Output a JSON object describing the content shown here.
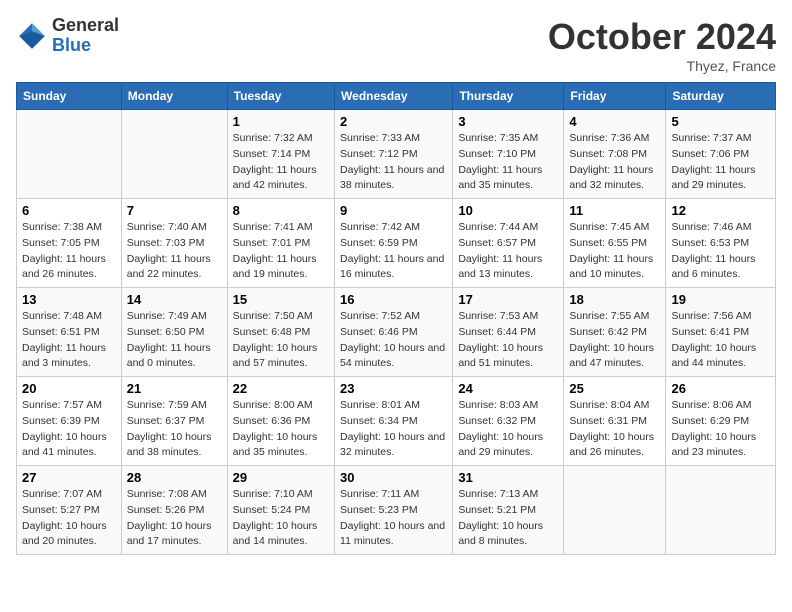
{
  "logo": {
    "general": "General",
    "blue": "Blue"
  },
  "header": {
    "month": "October 2024",
    "location": "Thyez, France"
  },
  "weekdays": [
    "Sunday",
    "Monday",
    "Tuesday",
    "Wednesday",
    "Thursday",
    "Friday",
    "Saturday"
  ],
  "weeks": [
    [
      {
        "day": "",
        "sunrise": "",
        "sunset": "",
        "daylight": ""
      },
      {
        "day": "",
        "sunrise": "",
        "sunset": "",
        "daylight": ""
      },
      {
        "day": "1",
        "sunrise": "Sunrise: 7:32 AM",
        "sunset": "Sunset: 7:14 PM",
        "daylight": "Daylight: 11 hours and 42 minutes."
      },
      {
        "day": "2",
        "sunrise": "Sunrise: 7:33 AM",
        "sunset": "Sunset: 7:12 PM",
        "daylight": "Daylight: 11 hours and 38 minutes."
      },
      {
        "day": "3",
        "sunrise": "Sunrise: 7:35 AM",
        "sunset": "Sunset: 7:10 PM",
        "daylight": "Daylight: 11 hours and 35 minutes."
      },
      {
        "day": "4",
        "sunrise": "Sunrise: 7:36 AM",
        "sunset": "Sunset: 7:08 PM",
        "daylight": "Daylight: 11 hours and 32 minutes."
      },
      {
        "day": "5",
        "sunrise": "Sunrise: 7:37 AM",
        "sunset": "Sunset: 7:06 PM",
        "daylight": "Daylight: 11 hours and 29 minutes."
      }
    ],
    [
      {
        "day": "6",
        "sunrise": "Sunrise: 7:38 AM",
        "sunset": "Sunset: 7:05 PM",
        "daylight": "Daylight: 11 hours and 26 minutes."
      },
      {
        "day": "7",
        "sunrise": "Sunrise: 7:40 AM",
        "sunset": "Sunset: 7:03 PM",
        "daylight": "Daylight: 11 hours and 22 minutes."
      },
      {
        "day": "8",
        "sunrise": "Sunrise: 7:41 AM",
        "sunset": "Sunset: 7:01 PM",
        "daylight": "Daylight: 11 hours and 19 minutes."
      },
      {
        "day": "9",
        "sunrise": "Sunrise: 7:42 AM",
        "sunset": "Sunset: 6:59 PM",
        "daylight": "Daylight: 11 hours and 16 minutes."
      },
      {
        "day": "10",
        "sunrise": "Sunrise: 7:44 AM",
        "sunset": "Sunset: 6:57 PM",
        "daylight": "Daylight: 11 hours and 13 minutes."
      },
      {
        "day": "11",
        "sunrise": "Sunrise: 7:45 AM",
        "sunset": "Sunset: 6:55 PM",
        "daylight": "Daylight: 11 hours and 10 minutes."
      },
      {
        "day": "12",
        "sunrise": "Sunrise: 7:46 AM",
        "sunset": "Sunset: 6:53 PM",
        "daylight": "Daylight: 11 hours and 6 minutes."
      }
    ],
    [
      {
        "day": "13",
        "sunrise": "Sunrise: 7:48 AM",
        "sunset": "Sunset: 6:51 PM",
        "daylight": "Daylight: 11 hours and 3 minutes."
      },
      {
        "day": "14",
        "sunrise": "Sunrise: 7:49 AM",
        "sunset": "Sunset: 6:50 PM",
        "daylight": "Daylight: 11 hours and 0 minutes."
      },
      {
        "day": "15",
        "sunrise": "Sunrise: 7:50 AM",
        "sunset": "Sunset: 6:48 PM",
        "daylight": "Daylight: 10 hours and 57 minutes."
      },
      {
        "day": "16",
        "sunrise": "Sunrise: 7:52 AM",
        "sunset": "Sunset: 6:46 PM",
        "daylight": "Daylight: 10 hours and 54 minutes."
      },
      {
        "day": "17",
        "sunrise": "Sunrise: 7:53 AM",
        "sunset": "Sunset: 6:44 PM",
        "daylight": "Daylight: 10 hours and 51 minutes."
      },
      {
        "day": "18",
        "sunrise": "Sunrise: 7:55 AM",
        "sunset": "Sunset: 6:42 PM",
        "daylight": "Daylight: 10 hours and 47 minutes."
      },
      {
        "day": "19",
        "sunrise": "Sunrise: 7:56 AM",
        "sunset": "Sunset: 6:41 PM",
        "daylight": "Daylight: 10 hours and 44 minutes."
      }
    ],
    [
      {
        "day": "20",
        "sunrise": "Sunrise: 7:57 AM",
        "sunset": "Sunset: 6:39 PM",
        "daylight": "Daylight: 10 hours and 41 minutes."
      },
      {
        "day": "21",
        "sunrise": "Sunrise: 7:59 AM",
        "sunset": "Sunset: 6:37 PM",
        "daylight": "Daylight: 10 hours and 38 minutes."
      },
      {
        "day": "22",
        "sunrise": "Sunrise: 8:00 AM",
        "sunset": "Sunset: 6:36 PM",
        "daylight": "Daylight: 10 hours and 35 minutes."
      },
      {
        "day": "23",
        "sunrise": "Sunrise: 8:01 AM",
        "sunset": "Sunset: 6:34 PM",
        "daylight": "Daylight: 10 hours and 32 minutes."
      },
      {
        "day": "24",
        "sunrise": "Sunrise: 8:03 AM",
        "sunset": "Sunset: 6:32 PM",
        "daylight": "Daylight: 10 hours and 29 minutes."
      },
      {
        "day": "25",
        "sunrise": "Sunrise: 8:04 AM",
        "sunset": "Sunset: 6:31 PM",
        "daylight": "Daylight: 10 hours and 26 minutes."
      },
      {
        "day": "26",
        "sunrise": "Sunrise: 8:06 AM",
        "sunset": "Sunset: 6:29 PM",
        "daylight": "Daylight: 10 hours and 23 minutes."
      }
    ],
    [
      {
        "day": "27",
        "sunrise": "Sunrise: 7:07 AM",
        "sunset": "Sunset: 5:27 PM",
        "daylight": "Daylight: 10 hours and 20 minutes."
      },
      {
        "day": "28",
        "sunrise": "Sunrise: 7:08 AM",
        "sunset": "Sunset: 5:26 PM",
        "daylight": "Daylight: 10 hours and 17 minutes."
      },
      {
        "day": "29",
        "sunrise": "Sunrise: 7:10 AM",
        "sunset": "Sunset: 5:24 PM",
        "daylight": "Daylight: 10 hours and 14 minutes."
      },
      {
        "day": "30",
        "sunrise": "Sunrise: 7:11 AM",
        "sunset": "Sunset: 5:23 PM",
        "daylight": "Daylight: 10 hours and 11 minutes."
      },
      {
        "day": "31",
        "sunrise": "Sunrise: 7:13 AM",
        "sunset": "Sunset: 5:21 PM",
        "daylight": "Daylight: 10 hours and 8 minutes."
      },
      {
        "day": "",
        "sunrise": "",
        "sunset": "",
        "daylight": ""
      },
      {
        "day": "",
        "sunrise": "",
        "sunset": "",
        "daylight": ""
      }
    ]
  ]
}
